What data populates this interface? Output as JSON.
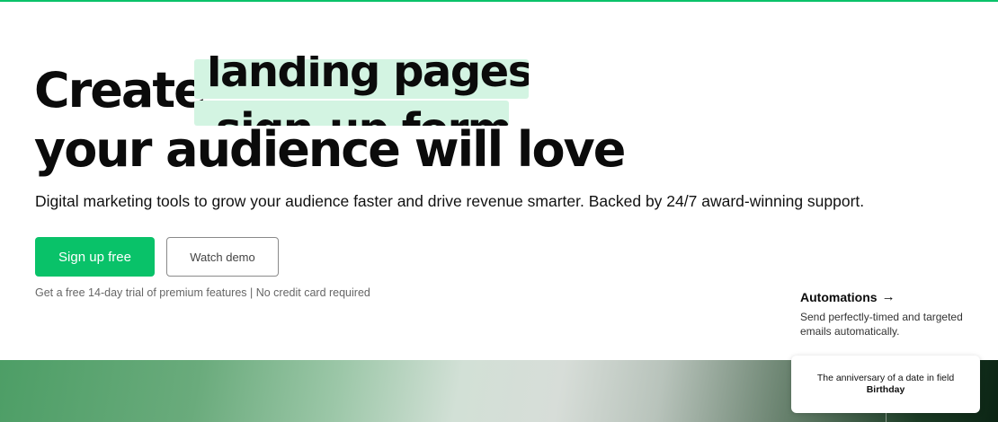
{
  "hero": {
    "title_prefix": "Create",
    "rotating_current": "landing pages",
    "rotating_next": "sign-up forms",
    "title_line2": "your audience will love",
    "subtitle": "Digital marketing tools to grow your audience faster and drive revenue smarter. Backed by 24/7 award-winning support.",
    "primary_cta": "Sign up free",
    "secondary_cta": "Watch demo",
    "trial_note": "Get a free 14-day trial of premium features | No credit card required"
  },
  "feature": {
    "title": "Automations",
    "arrow": "→",
    "description": "Send perfectly-timed and targeted emails automatically."
  },
  "trigger_card": {
    "text_prefix": "The anniversary of a date in field",
    "field_name": "Birthday"
  },
  "colors": {
    "brand_green": "#09c269",
    "highlight": "#d3f4e2",
    "text": "#0b0b0b"
  }
}
